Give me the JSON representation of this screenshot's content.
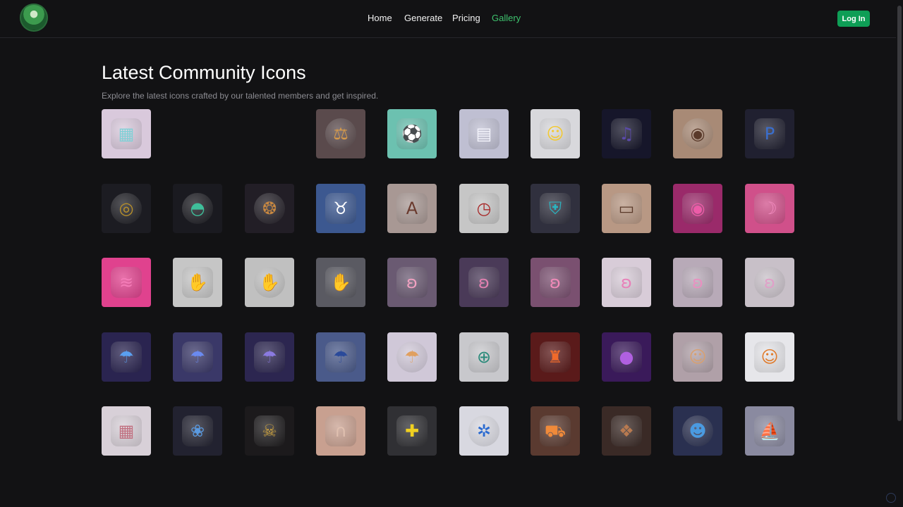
{
  "nav": {
    "links": [
      "Home",
      "Generate",
      "Pricing",
      "Gallery"
    ],
    "active_index": 3,
    "login_label": "Log In"
  },
  "header": {
    "title": "Latest Community Icons",
    "subtitle": "Explore the latest icons crafted by our talented members and get inspired."
  },
  "colors": {
    "accent": "#3ec26e",
    "login_bg": "#0e9e56",
    "background": "#121214"
  },
  "gallery": [
    {
      "name": "isometric-building",
      "bg": "#d9c9dc",
      "fg": "#7fd0d6",
      "glyph": "▦"
    },
    {
      "name": "empty-slot-1",
      "bg": "transparent",
      "fg": "transparent",
      "glyph": ""
    },
    {
      "name": "empty-slot-2",
      "bg": "transparent",
      "fg": "transparent",
      "glyph": ""
    },
    {
      "name": "scales-of-justice",
      "bg": "#5a4a4c",
      "fg": "#d79a4a",
      "glyph": "⚖",
      "round": true
    },
    {
      "name": "soccer-field",
      "bg": "#6cc1b0",
      "fg": "#2c6b64",
      "glyph": "⚽"
    },
    {
      "name": "dashboard-ui",
      "bg": "#bfbfd2",
      "fg": "#f3f3fb",
      "glyph": "▤"
    },
    {
      "name": "adventurer-character",
      "bg": "#d8d8dc",
      "fg": "#f2c933",
      "glyph": "☺"
    },
    {
      "name": "music-note",
      "bg": "#16162a",
      "fg": "#5a4aa8",
      "glyph": "♫"
    },
    {
      "name": "eye",
      "bg": "#a88a76",
      "fg": "#5a3a2a",
      "glyph": "◉",
      "round": true
    },
    {
      "name": "letter-p",
      "bg": "#202030",
      "fg": "#3a6fd0",
      "glyph": "P"
    },
    {
      "name": "radar",
      "bg": "#1c1c22",
      "fg": "#b8902a",
      "glyph": "◎",
      "round": true
    },
    {
      "name": "ufo",
      "bg": "#1a1a20",
      "fg": "#3fbf9a",
      "glyph": "◓",
      "round": true
    },
    {
      "name": "phoenix-swirl",
      "bg": "#221e26",
      "fg": "#c98840",
      "glyph": "❂",
      "round": true
    },
    {
      "name": "cow",
      "bg": "#3c5890",
      "fg": "#ffffff",
      "glyph": "♉"
    },
    {
      "name": "letter-a",
      "bg": "#a89894",
      "fg": "#6a3a2e",
      "glyph": "A"
    },
    {
      "name": "clock",
      "bg": "#c6c6c6",
      "fg": "#a82a2a",
      "glyph": "◷"
    },
    {
      "name": "shield",
      "bg": "#30303e",
      "fg": "#2bb4c0",
      "glyph": "⛨"
    },
    {
      "name": "id-card",
      "bg": "#b89884",
      "fg": "#5a3a2a",
      "glyph": "▭"
    },
    {
      "name": "camera-pink",
      "bg": "#9a2a6a",
      "fg": "#ec5ca8",
      "glyph": "◉"
    },
    {
      "name": "moon-pink",
      "bg": "#d0508a",
      "fg": "#f38cc0",
      "glyph": "☽"
    },
    {
      "name": "wave-pink",
      "bg": "#e0428e",
      "fg": "#f57cb8",
      "glyph": "≋"
    },
    {
      "name": "hand-green",
      "bg": "#c6c6c6",
      "fg": "#2a8a6a",
      "glyph": "✋"
    },
    {
      "name": "hand-circle",
      "bg": "#c0c0c0",
      "fg": "#2a7a5a",
      "glyph": "✋",
      "round": true
    },
    {
      "name": "hand-teal",
      "bg": "#5a5a62",
      "fg": "#2a9a7a",
      "glyph": "✋"
    },
    {
      "name": "axolotl-1",
      "bg": "#6a5a72",
      "fg": "#f0a0c0",
      "glyph": "ʚ"
    },
    {
      "name": "axolotl-2",
      "bg": "#4a3a58",
      "fg": "#e080b0",
      "glyph": "ʚ"
    },
    {
      "name": "axolotl-3",
      "bg": "#7a5070",
      "fg": "#f08ab8",
      "glyph": "ʚ"
    },
    {
      "name": "axolotl-4",
      "bg": "#d8ccd8",
      "fg": "#e880b8",
      "glyph": "ʚ"
    },
    {
      "name": "axolotl-5",
      "bg": "#b8aab8",
      "fg": "#e890c0",
      "glyph": "ʚ"
    },
    {
      "name": "axolotl-6",
      "bg": "#c8c0c8",
      "fg": "#e0a0c8",
      "glyph": "ʚ",
      "round": true
    },
    {
      "name": "jellyfish-1",
      "bg": "#2a2450",
      "fg": "#5aa0f0",
      "glyph": "☂"
    },
    {
      "name": "jellyfish-2",
      "bg": "#3a3868",
      "fg": "#6a8af0",
      "glyph": "☂"
    },
    {
      "name": "jellyfish-3",
      "bg": "#2c2650",
      "fg": "#8a7ae0",
      "glyph": "☂"
    },
    {
      "name": "jellyfish-4",
      "bg": "#4a5a8a",
      "fg": "#2a4a9a",
      "glyph": "☂"
    },
    {
      "name": "jellyfish-5",
      "bg": "#d0c8d8",
      "fg": "#e0a060",
      "glyph": "☂",
      "round": true
    },
    {
      "name": "compass-target",
      "bg": "#c8c8cc",
      "fg": "#2a8a7a",
      "glyph": "⊕"
    },
    {
      "name": "haunted-castle",
      "bg": "#5a1a1a",
      "fg": "#f06a2a",
      "glyph": "♜"
    },
    {
      "name": "purple-apple",
      "bg": "#3a1a5a",
      "fg": "#b060e0",
      "glyph": "●"
    },
    {
      "name": "statue-face",
      "bg": "#b0a0a8",
      "fg": "#d8a070",
      "glyph": "☺"
    },
    {
      "name": "squirrel-doctor",
      "bg": "#e6e6ea",
      "fg": "#e07a2a",
      "glyph": "☺"
    },
    {
      "name": "isometric-room",
      "bg": "#d8d0d8",
      "fg": "#c07080",
      "glyph": "▦"
    },
    {
      "name": "flower-pattern",
      "bg": "#222230",
      "fg": "#5a9ae0",
      "glyph": "❀"
    },
    {
      "name": "skull-shield",
      "bg": "#1c1a1c",
      "fg": "#c9a040",
      "glyph": "☠"
    },
    {
      "name": "arched-door",
      "bg": "#c8a090",
      "fg": "#e0c0b0",
      "glyph": "∩"
    },
    {
      "name": "puzzle-piece",
      "bg": "#303034",
      "fg": "#f0d020",
      "glyph": "✚"
    },
    {
      "name": "integration-hub",
      "bg": "#d8d8e0",
      "fg": "#2a6ad0",
      "glyph": "✲",
      "round": true
    },
    {
      "name": "car-cone",
      "bg": "#5a3a30",
      "fg": "#f08a3a",
      "glyph": "⛟"
    },
    {
      "name": "ornate-pattern",
      "bg": "#3a2a26",
      "fg": "#b87a50",
      "glyph": "❖"
    },
    {
      "name": "robot",
      "bg": "#2a3050",
      "fg": "#4a9ae0",
      "glyph": "☻",
      "round": true
    },
    {
      "name": "boat",
      "bg": "#8a8aa0",
      "fg": "#5ab8e8",
      "glyph": "⛵"
    }
  ]
}
